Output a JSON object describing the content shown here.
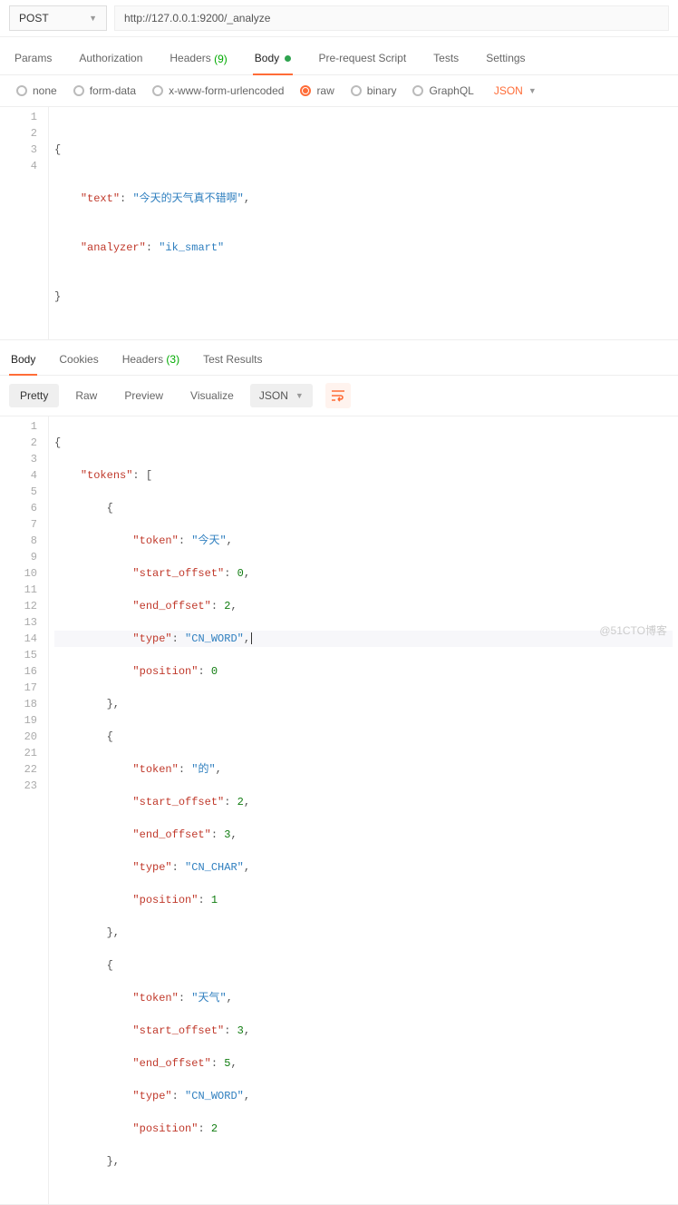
{
  "request": {
    "method": "POST",
    "url": "http://127.0.0.1:9200/_analyze"
  },
  "reqTabs": {
    "params": "Params",
    "auth": "Authorization",
    "headers": "Headers",
    "headersCount": "(9)",
    "body": "Body",
    "prereq": "Pre-request Script",
    "tests": "Tests",
    "settings": "Settings"
  },
  "bodyTypes": {
    "none": "none",
    "formdata": "form-data",
    "urlencoded": "x-www-form-urlencoded",
    "raw": "raw",
    "binary": "binary",
    "graphql": "GraphQL",
    "format": "JSON"
  },
  "reqBody": {
    "textKey": "\"text\"",
    "textVal": "\"今天的天气真不错啊\"",
    "analyzerKey": "\"analyzer\"",
    "analyzerVal": "\"ik_smart\""
  },
  "respTabs": {
    "body": "Body",
    "cookies": "Cookies",
    "headers": "Headers",
    "headersCount": "(3)",
    "test": "Test Results"
  },
  "toolbar": {
    "pretty": "Pretty",
    "raw": "Raw",
    "preview": "Preview",
    "visualize": "Visualize",
    "format": "JSON"
  },
  "resp": {
    "tokensKey": "\"tokens\"",
    "tokenKey": "\"token\"",
    "startKey": "\"start_offset\"",
    "endKey": "\"end_offset\"",
    "typeKey": "\"type\"",
    "posKey": "\"position\"",
    "items": [
      {
        "token": "\"今天\"",
        "start": "0",
        "end": "2",
        "type": "\"CN_WORD\"",
        "pos": "0"
      },
      {
        "token": "\"的\"",
        "start": "2",
        "end": "3",
        "type": "\"CN_CHAR\"",
        "pos": "1"
      },
      {
        "token": "\"天气\"",
        "start": "3",
        "end": "5",
        "type": "\"CN_WORD\"",
        "pos": "2"
      }
    ]
  },
  "watermark": "@51CTO博客"
}
